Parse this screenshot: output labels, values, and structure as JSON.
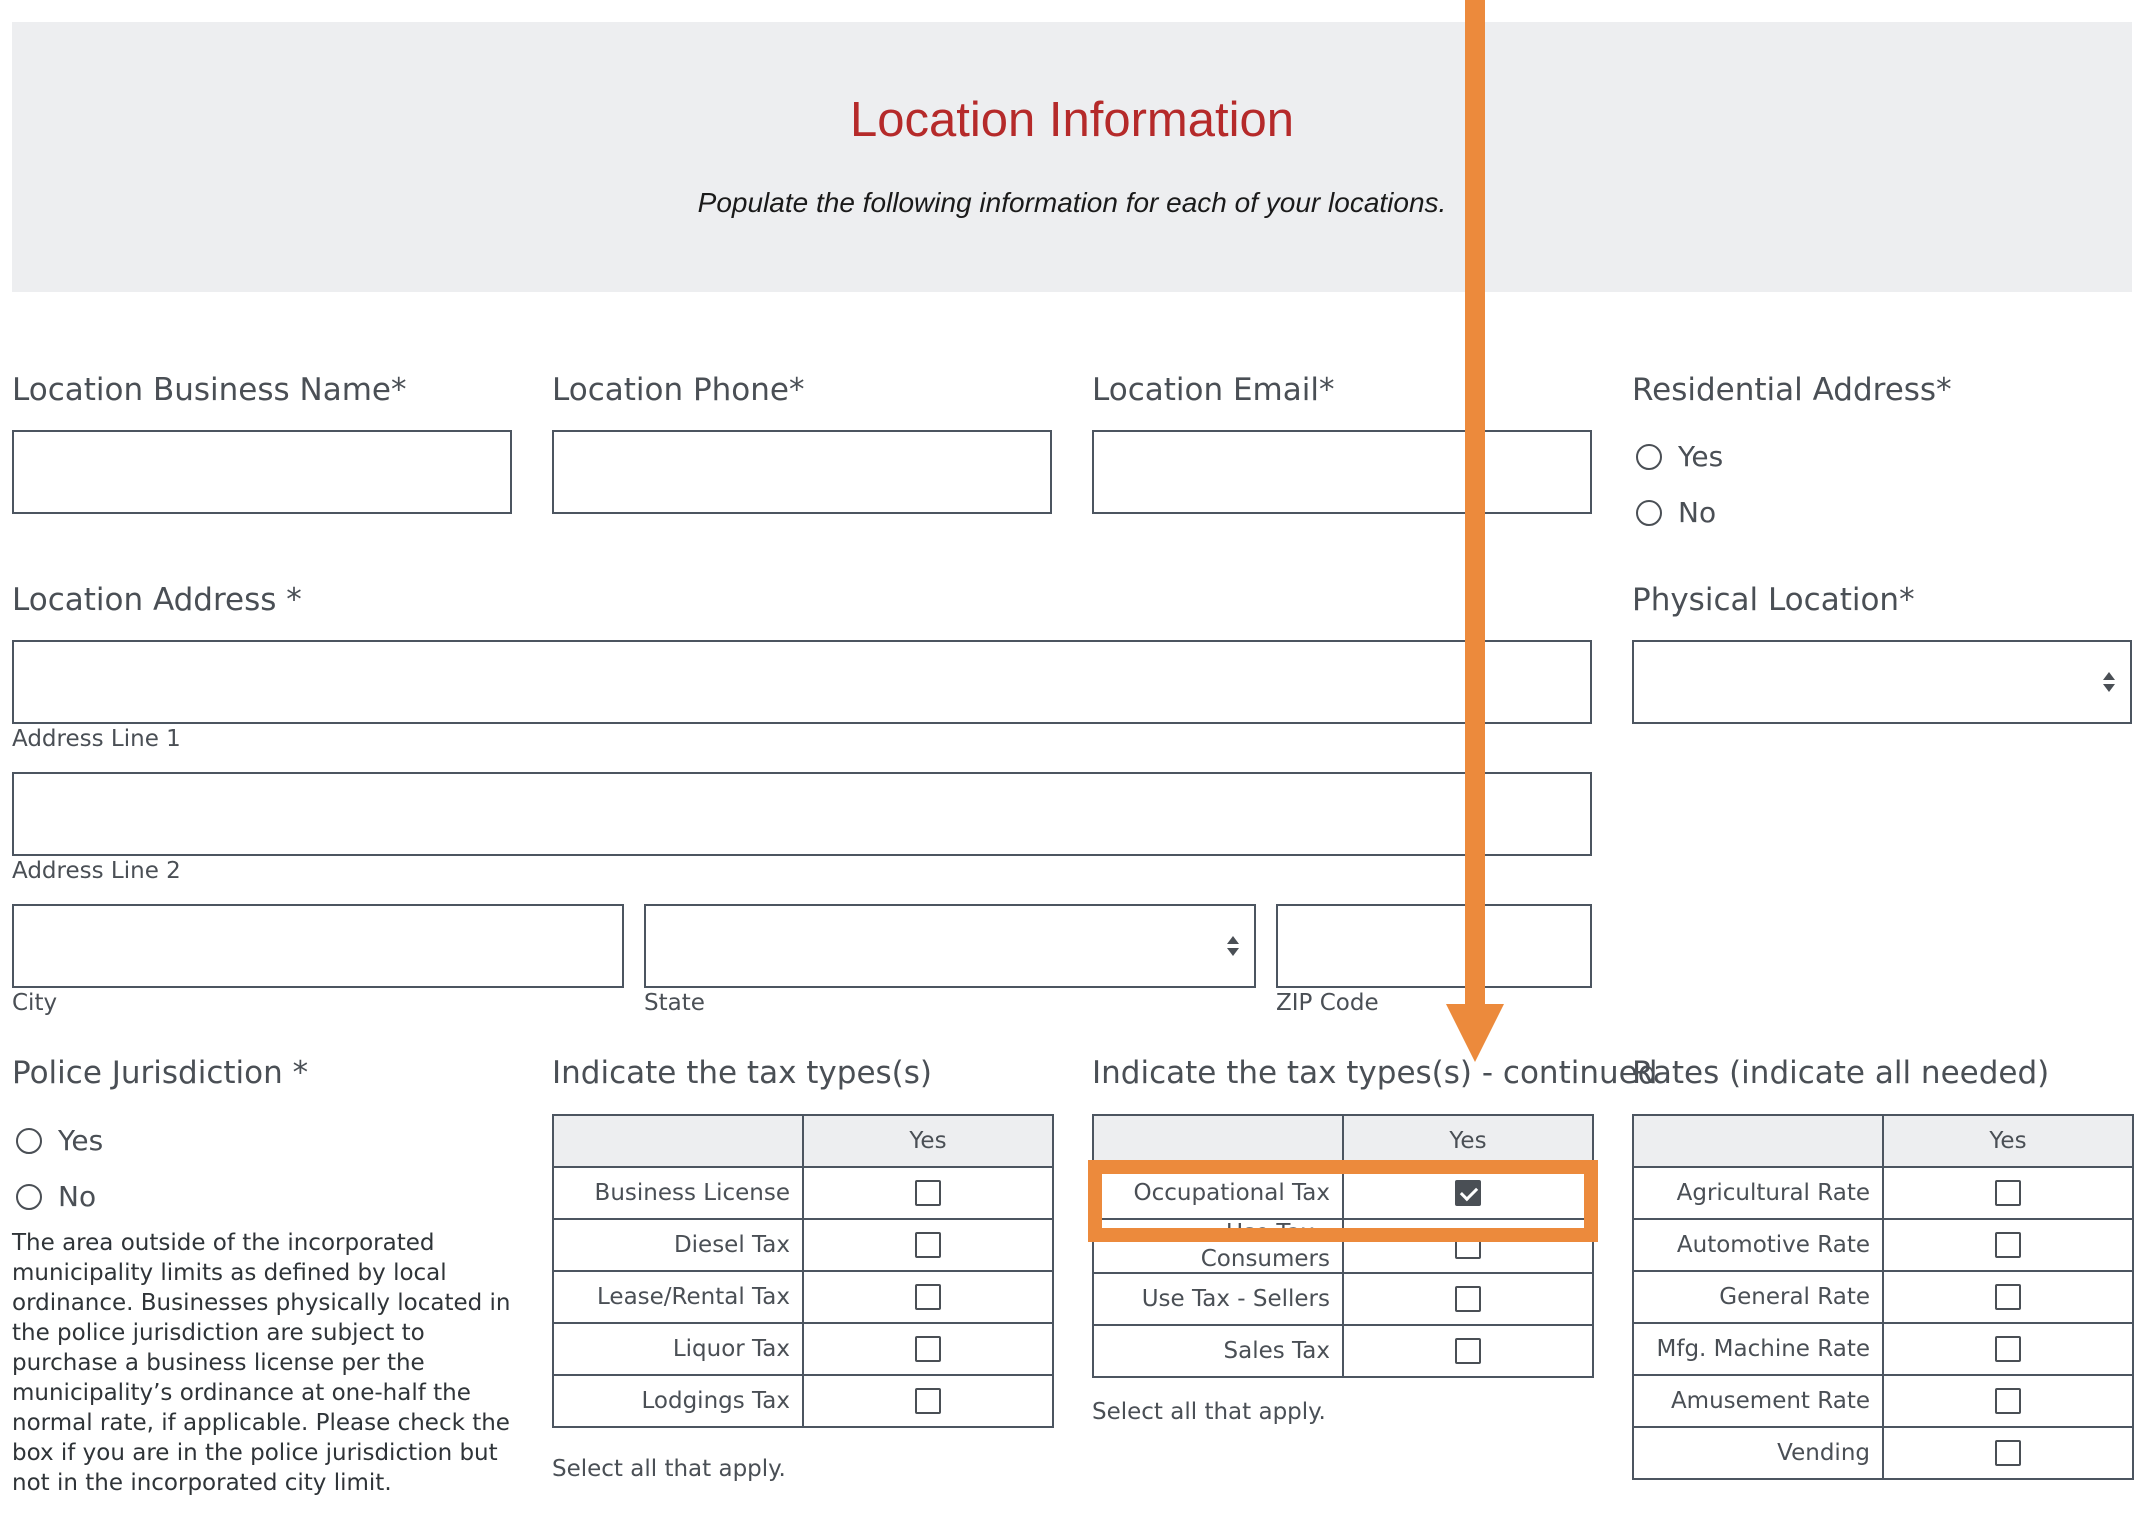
{
  "header": {
    "title": "Location Information",
    "subtitle": "Populate the following information for each of your locations."
  },
  "fields": {
    "business_name": {
      "label": "Location Business Name*",
      "value": ""
    },
    "phone": {
      "label": "Location Phone*",
      "value": ""
    },
    "email": {
      "label": "Location Email*",
      "value": ""
    },
    "residential": {
      "label": "Residential Address*",
      "options": [
        "Yes",
        "No"
      ]
    },
    "address": {
      "label": "Location Address *",
      "line1_label": "Address Line 1",
      "line2_label": "Address Line 2",
      "city_label": "City",
      "state_label": "State",
      "zip_label": "ZIP Code"
    },
    "physical_location": {
      "label": "Physical Location*",
      "value": ""
    },
    "police": {
      "label": "Police Jurisdiction *",
      "options": [
        "Yes",
        "No"
      ],
      "help": "The area outside of the incorporated municipality limits as defined by local ordinance. Businesses physically located in the police jurisdiction are subject to purchase a business license per the municipality’s ordinance at one-half the normal rate, if applicable. Please check the box if you are in the police jurisdiction but not in the incorporated city limit."
    }
  },
  "tax_table_1": {
    "label": "Indicate the tax types(s)",
    "column": "Yes",
    "rows": [
      {
        "name": "Business License",
        "checked": false
      },
      {
        "name": "Diesel Tax",
        "checked": false
      },
      {
        "name": "Lease/Rental Tax",
        "checked": false
      },
      {
        "name": "Liquor Tax",
        "checked": false
      },
      {
        "name": "Lodgings Tax",
        "checked": false
      }
    ],
    "note": "Select all that apply."
  },
  "tax_table_2": {
    "label": "Indicate the tax types(s) - continued",
    "column": "Yes",
    "rows": [
      {
        "name": "Occupational Tax",
        "checked": true
      },
      {
        "name": "Use Tax - Consumers",
        "checked": false
      },
      {
        "name": "Use Tax - Sellers",
        "checked": false
      },
      {
        "name": "Sales Tax",
        "checked": false
      }
    ],
    "note": "Select all that apply."
  },
  "rates_table": {
    "label": "Rates (indicate all needed)",
    "column": "Yes",
    "rows": [
      {
        "name": "Agricultural Rate",
        "checked": false
      },
      {
        "name": "Automotive Rate",
        "checked": false
      },
      {
        "name": "General Rate",
        "checked": false
      },
      {
        "name": "Mfg. Machine Rate",
        "checked": false
      },
      {
        "name": "Amusement Rate",
        "checked": false
      },
      {
        "name": "Vending",
        "checked": false
      }
    ]
  },
  "annotation": {
    "color": "#ec8a3c"
  }
}
